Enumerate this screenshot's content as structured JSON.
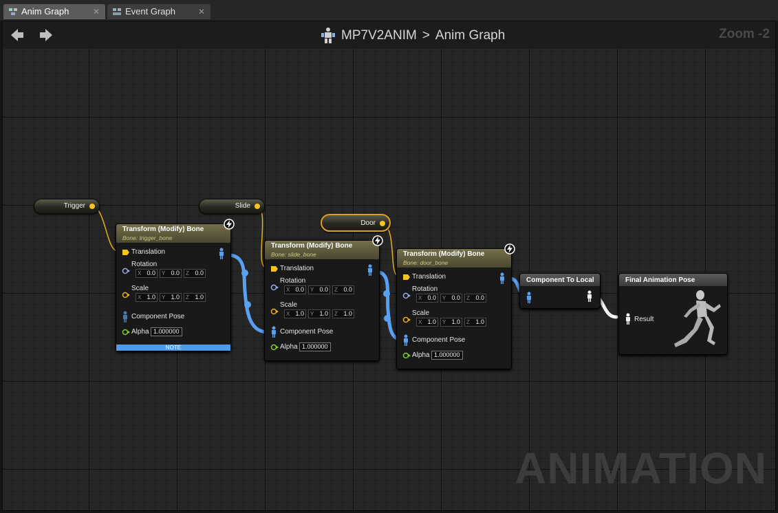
{
  "tabs": [
    {
      "label": "Anim Graph",
      "close": "✕",
      "icon": "anim-graph-icon"
    },
    {
      "label": "Event Graph",
      "close": "✕",
      "icon": "event-graph-icon"
    }
  ],
  "breadcrumb": {
    "asset": "MP7V2ANIM",
    "separator": ">",
    "graph": "Anim Graph",
    "icon": "anim-blueprint-icon"
  },
  "zoom": "Zoom -2",
  "watermark": "ANIMATION",
  "variables": [
    {
      "label": "Trigger"
    },
    {
      "label": "Slide"
    },
    {
      "label": "Door"
    }
  ],
  "bone_nodes": [
    {
      "title": "Transform (Modify) Bone",
      "bone": "Bone: trigger_bone",
      "translation": "Translation",
      "rotation": "Rotation",
      "rx": "0.0",
      "ry": "0.0",
      "rz": "0.0",
      "scale": "Scale",
      "sx": "1.0",
      "sy": "1.0",
      "sz": "1.0",
      "pose": "Component Pose",
      "alpha_label": "Alpha",
      "alpha": "1.000000",
      "note": "NOTE"
    },
    {
      "title": "Transform (Modify) Bone",
      "bone": "Bone: slide_bone",
      "translation": "Translation",
      "rotation": "Rotation",
      "rx": "0.0",
      "ry": "0.0",
      "rz": "0.0",
      "scale": "Scale",
      "sx": "1.0",
      "sy": "1.0",
      "sz": "1.0",
      "pose": "Component Pose",
      "alpha_label": "Alpha",
      "alpha": "1.000000"
    },
    {
      "title": "Transform (Modify) Bone",
      "bone": "Bone: door_bone",
      "translation": "Translation",
      "rotation": "Rotation",
      "rx": "0.0",
      "ry": "0.0",
      "rz": "0.0",
      "scale": "Scale",
      "sx": "1.0",
      "sy": "1.0",
      "sz": "1.0",
      "pose": "Component Pose",
      "alpha_label": "Alpha",
      "alpha": "1.000000"
    }
  ],
  "axes": {
    "x": "X",
    "y": "Y",
    "z": "Z"
  },
  "component_to_local": {
    "title": "Component To Local"
  },
  "final_pose": {
    "title": "Final Animation Pose",
    "result": "Result"
  },
  "colors": {
    "exec_float": "#f5c51b",
    "pose_wire": "#5aa0f0",
    "rotation_pin": "#9aa8e0",
    "scale_pin": "#e8b020",
    "alpha_pin": "#7fd02a",
    "note_bar": "#4d9ce8"
  }
}
